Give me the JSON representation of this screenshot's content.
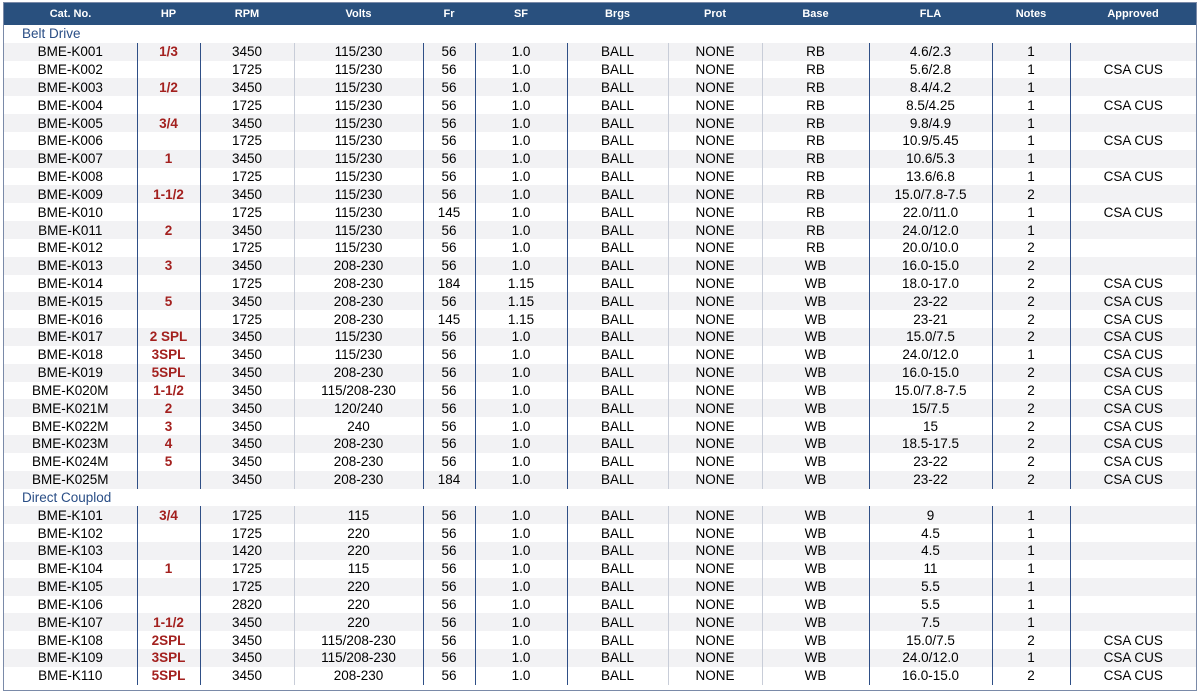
{
  "columns": [
    "Cat. No.",
    "HP",
    "RPM",
    "Volts",
    "Fr",
    "SF",
    "Brgs",
    "Prot",
    "Base",
    "FLA",
    "Notes",
    "Approved"
  ],
  "sections": [
    {
      "title": "Belt Drive",
      "rows": [
        [
          "BME-K001",
          "1/3",
          "3450",
          "115/230",
          "56",
          "1.0",
          "BALL",
          "NONE",
          "RB",
          "4.6/2.3",
          "1",
          ""
        ],
        [
          "BME-K002",
          "",
          "1725",
          "115/230",
          "56",
          "1.0",
          "BALL",
          "NONE",
          "RB",
          "5.6/2.8",
          "1",
          "CSA CUS"
        ],
        [
          "BME-K003",
          "1/2",
          "3450",
          "115/230",
          "56",
          "1.0",
          "BALL",
          "NONE",
          "RB",
          "8.4/4.2",
          "1",
          ""
        ],
        [
          "BME-K004",
          "",
          "1725",
          "115/230",
          "56",
          "1.0",
          "BALL",
          "NONE",
          "RB",
          "8.5/4.25",
          "1",
          "CSA CUS"
        ],
        [
          "BME-K005",
          "3/4",
          "3450",
          "115/230",
          "56",
          "1.0",
          "BALL",
          "NONE",
          "RB",
          "9.8/4.9",
          "1",
          ""
        ],
        [
          "BME-K006",
          "",
          "1725",
          "115/230",
          "56",
          "1.0",
          "BALL",
          "NONE",
          "RB",
          "10.9/5.45",
          "1",
          "CSA CUS"
        ],
        [
          "BME-K007",
          "1",
          "3450",
          "115/230",
          "56",
          "1.0",
          "BALL",
          "NONE",
          "RB",
          "10.6/5.3",
          "1",
          ""
        ],
        [
          "BME-K008",
          "",
          "1725",
          "115/230",
          "56",
          "1.0",
          "BALL",
          "NONE",
          "RB",
          "13.6/6.8",
          "1",
          "CSA CUS"
        ],
        [
          "BME-K009",
          "1-1/2",
          "3450",
          "115/230",
          "56",
          "1.0",
          "BALL",
          "NONE",
          "RB",
          "15.0/7.8-7.5",
          "2",
          ""
        ],
        [
          "BME-K010",
          "",
          "1725",
          "115/230",
          "145",
          "1.0",
          "BALL",
          "NONE",
          "RB",
          "22.0/11.0",
          "1",
          "CSA CUS"
        ],
        [
          "BME-K011",
          "2",
          "3450",
          "115/230",
          "56",
          "1.0",
          "BALL",
          "NONE",
          "RB",
          "24.0/12.0",
          "1",
          ""
        ],
        [
          "BME-K012",
          "",
          "1725",
          "115/230",
          "56",
          "1.0",
          "BALL",
          "NONE",
          "RB",
          "20.0/10.0",
          "2",
          ""
        ],
        [
          "BME-K013",
          "3",
          "3450",
          "208-230",
          "56",
          "1.0",
          "BALL",
          "NONE",
          "WB",
          "16.0-15.0",
          "2",
          ""
        ],
        [
          "BME-K014",
          "",
          "1725",
          "208-230",
          "184",
          "1.15",
          "BALL",
          "NONE",
          "WB",
          "18.0-17.0",
          "2",
          "CSA CUS"
        ],
        [
          "BME-K015",
          "5",
          "3450",
          "208-230",
          "56",
          "1.15",
          "BALL",
          "NONE",
          "WB",
          "23-22",
          "2",
          "CSA CUS"
        ],
        [
          "BME-K016",
          "",
          "1725",
          "208-230",
          "145",
          "1.15",
          "BALL",
          "NONE",
          "WB",
          "23-21",
          "2",
          "CSA CUS"
        ],
        [
          "BME-K017",
          "2 SPL",
          "3450",
          "115/230",
          "56",
          "1.0",
          "BALL",
          "NONE",
          "WB",
          "15.0/7.5",
          "2",
          "CSA CUS"
        ],
        [
          "BME-K018",
          "3SPL",
          "3450",
          "115/230",
          "56",
          "1.0",
          "BALL",
          "NONE",
          "WB",
          "24.0/12.0",
          "1",
          "CSA CUS"
        ],
        [
          "BME-K019",
          "5SPL",
          "3450",
          "208-230",
          "56",
          "1.0",
          "BALL",
          "NONE",
          "WB",
          "16.0-15.0",
          "2",
          "CSA CUS"
        ],
        [
          "BME-K020M",
          "1-1/2",
          "3450",
          "115/208-230",
          "56",
          "1.0",
          "BALL",
          "NONE",
          "WB",
          "15.0/7.8-7.5",
          "2",
          "CSA CUS"
        ],
        [
          "BME-K021M",
          "2",
          "3450",
          "120/240",
          "56",
          "1.0",
          "BALL",
          "NONE",
          "WB",
          "15/7.5",
          "2",
          "CSA CUS"
        ],
        [
          "BME-K022M",
          "3",
          "3450",
          "240",
          "56",
          "1.0",
          "BALL",
          "NONE",
          "WB",
          "15",
          "2",
          "CSA CUS"
        ],
        [
          "BME-K023M",
          "4",
          "3450",
          "208-230",
          "56",
          "1.0",
          "BALL",
          "NONE",
          "WB",
          "18.5-17.5",
          "2",
          "CSA CUS"
        ],
        [
          "BME-K024M",
          "5",
          "3450",
          "208-230",
          "56",
          "1.0",
          "BALL",
          "NONE",
          "WB",
          "23-22",
          "2",
          "CSA CUS"
        ],
        [
          "BME-K025M",
          "",
          "3450",
          "208-230",
          "184",
          "1.0",
          "BALL",
          "NONE",
          "WB",
          "23-22",
          "2",
          "CSA CUS"
        ]
      ]
    },
    {
      "title": "Direct Couplod",
      "rows": [
        [
          "BME-K101",
          "3/4",
          "1725",
          "115",
          "56",
          "1.0",
          "BALL",
          "NONE",
          "WB",
          "9",
          "1",
          ""
        ],
        [
          "BME-K102",
          "",
          "1725",
          "220",
          "56",
          "1.0",
          "BALL",
          "NONE",
          "WB",
          "4.5",
          "1",
          ""
        ],
        [
          "BME-K103",
          "",
          "1420",
          "220",
          "56",
          "1.0",
          "BALL",
          "NONE",
          "WB",
          "4.5",
          "1",
          ""
        ],
        [
          "BME-K104",
          "1",
          "1725",
          "115",
          "56",
          "1.0",
          "BALL",
          "NONE",
          "WB",
          "11",
          "1",
          ""
        ],
        [
          "BME-K105",
          "",
          "1725",
          "220",
          "56",
          "1.0",
          "BALL",
          "NONE",
          "WB",
          "5.5",
          "1",
          ""
        ],
        [
          "BME-K106",
          "",
          "2820",
          "220",
          "56",
          "1.0",
          "BALL",
          "NONE",
          "WB",
          "5.5",
          "1",
          ""
        ],
        [
          "BME-K107",
          "1-1/2",
          "3450",
          "220",
          "56",
          "1.0",
          "BALL",
          "NONE",
          "WB",
          "7.5",
          "1",
          ""
        ],
        [
          "BME-K108",
          "2SPL",
          "3450",
          "115/208-230",
          "56",
          "1.0",
          "BALL",
          "NONE",
          "WB",
          "15.0/7.5",
          "2",
          "CSA CUS"
        ],
        [
          "BME-K109",
          "3SPL",
          "3450",
          "115/208-230",
          "56",
          "1.0",
          "BALL",
          "NONE",
          "WB",
          "24.0/12.0",
          "1",
          "CSA CUS"
        ],
        [
          "BME-K110",
          "5SPL",
          "3450",
          "208-230",
          "56",
          "1.0",
          "BALL",
          "NONE",
          "WB",
          "16.0-15.0",
          "2",
          "CSA CUS"
        ]
      ]
    }
  ]
}
